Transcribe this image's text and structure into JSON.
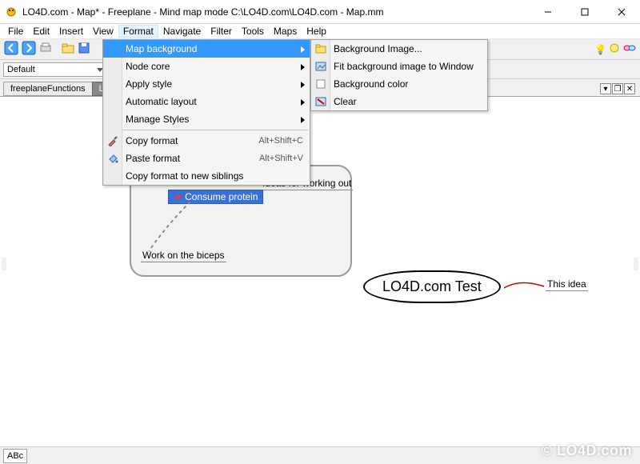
{
  "title": "LO4D.com - Map* - Freeplane - Mind map mode C:\\LO4D.com\\LO4D.com - Map.mm",
  "menu": [
    "File",
    "Edit",
    "Insert",
    "View",
    "Format",
    "Navigate",
    "Filter",
    "Tools",
    "Maps",
    "Help"
  ],
  "active_menu_index": 4,
  "toolbar_icons": [
    "nav-back",
    "nav-forward",
    "print",
    "copy",
    "paste",
    "open",
    "save",
    "undo",
    "redo",
    "zoom-combo",
    "search",
    "bold",
    "italic",
    "icon-lamp",
    "icon-light",
    "icon-misc"
  ],
  "style_combo": "Default",
  "tabs": [
    {
      "label": "freeplaneFunctions",
      "active": false
    },
    {
      "label": "LO4",
      "active": true
    }
  ],
  "tab_controls": [
    "min",
    "max",
    "close"
  ],
  "format_menu": {
    "items": [
      {
        "label": "Map background",
        "submenu": true,
        "highlight": true,
        "icon": null
      },
      {
        "label": "Node core",
        "submenu": true,
        "icon": null
      },
      {
        "label": "Apply style",
        "submenu": true,
        "icon": null
      },
      {
        "label": "Automatic layout",
        "submenu": true,
        "icon": null
      },
      {
        "label": "Manage Styles",
        "submenu": true,
        "icon": null
      },
      {
        "sep": true
      },
      {
        "label": "Copy format",
        "shortcut": "Alt+Shift+C",
        "icon": "eyedropper"
      },
      {
        "label": "Paste format",
        "shortcut": "Alt+Shift+V",
        "icon": "paint-bucket"
      },
      {
        "label": "Copy format to new siblings",
        "icon": null
      }
    ]
  },
  "submenu": {
    "items": [
      {
        "label": "Background Image...",
        "icon": "folder-image"
      },
      {
        "label": "Fit background image to Window",
        "icon": "fit-image"
      },
      {
        "label": "Background color",
        "icon": "color-swatch"
      },
      {
        "label": "Clear",
        "icon": "clear-image"
      }
    ]
  },
  "mindmap": {
    "cloud_nodes": {
      "root": "Consume protein",
      "top_right": "Ideas for working out",
      "bottom_left": "Work on the biceps"
    },
    "main_root": "LO4D.com Test",
    "right_child": "This idea"
  },
  "status": {
    "abc": "ABc"
  },
  "watermark": "© LO4D.com"
}
